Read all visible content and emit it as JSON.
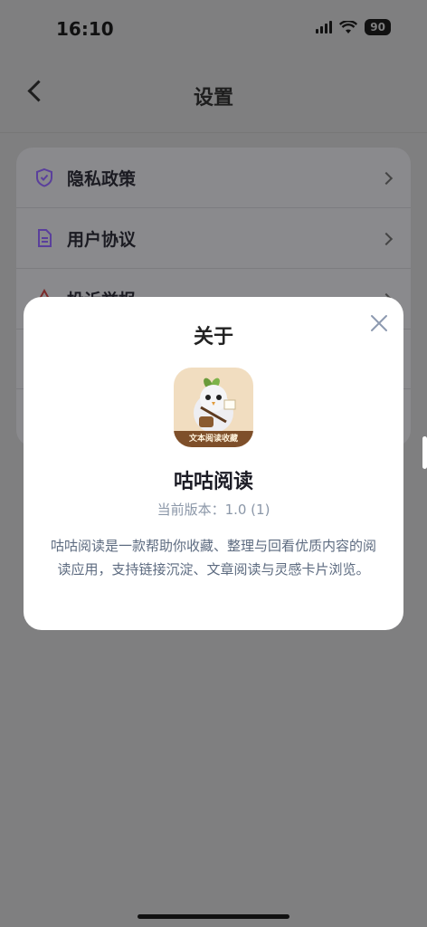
{
  "status": {
    "time": "16:10",
    "battery": "90"
  },
  "nav": {
    "title": "设置"
  },
  "settings": {
    "items": [
      {
        "label": "隐私政策",
        "icon": "shield-check-icon"
      },
      {
        "label": "用户协议",
        "icon": "document-icon"
      },
      {
        "label": "投诉举报",
        "icon": "warning-icon"
      }
    ]
  },
  "modal": {
    "title": "关于",
    "app_name": "咕咕阅读",
    "icon_caption": "文本阅读收藏",
    "version": "当前版本：1.0 (1)",
    "description": "咕咕阅读是一款帮助你收藏、整理与回看优质内容的阅读应用，支持链接沉淀、文章阅读与灵感卡片浏览。"
  },
  "colors": {
    "accent_purple": "#6b4fb3",
    "overlay": "#7f7f80",
    "modal_bg": "#ffffff"
  }
}
